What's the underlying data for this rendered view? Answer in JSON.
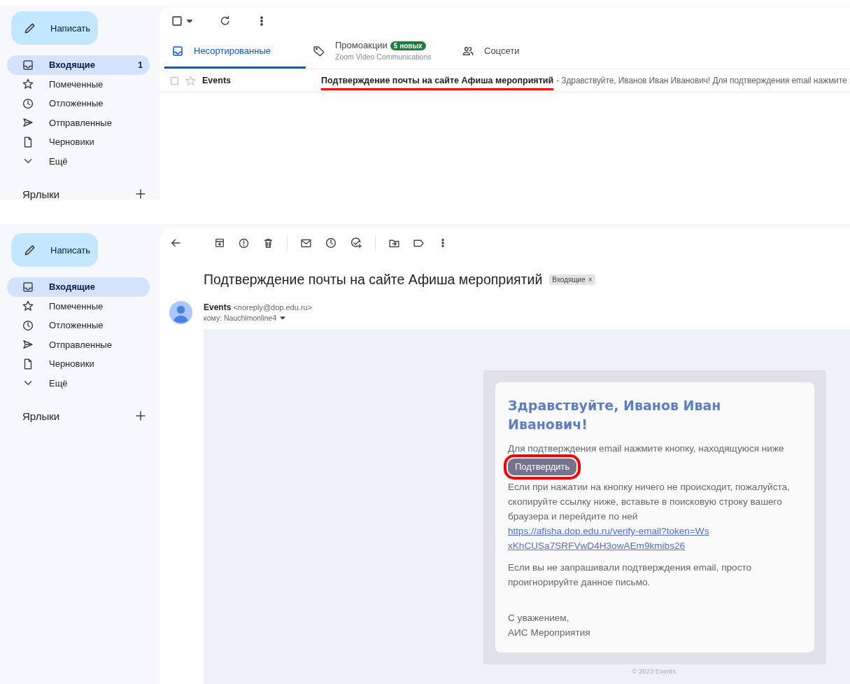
{
  "inbox_view": {
    "sidebar": {
      "compose": "Написать",
      "items": [
        {
          "label": "Входящие",
          "count": "1",
          "selected": true
        },
        {
          "label": "Помеченные",
          "selected": false
        },
        {
          "label": "Отложенные",
          "selected": false
        },
        {
          "label": "Отправленные",
          "selected": false
        },
        {
          "label": "Черновики",
          "selected": false
        },
        {
          "label": "Ещё",
          "selected": false
        }
      ],
      "labels_title": "Ярлыки"
    },
    "tabs": [
      {
        "label": "Несортированные",
        "selected": true
      },
      {
        "label": "Промоакции",
        "badge": "5 новых",
        "subtitle": "Zoom Video Communications",
        "selected": false
      },
      {
        "label": "Соцсети",
        "selected": false
      }
    ],
    "rows": [
      {
        "sender": "Events",
        "subject": "Подтверждение почты на сайте Афиша мероприятий",
        "snippet": "- Здравствуйте, Иванов Иван Иванович! Для подтверждения email нажмите",
        "unread": true,
        "starred": false,
        "annotated": true
      }
    ]
  },
  "message_view": {
    "sidebar": {
      "compose": "Написать",
      "items": [
        {
          "label": "Входящие",
          "selected": true
        },
        {
          "label": "Помеченные",
          "selected": false
        },
        {
          "label": "Отложенные",
          "selected": false
        },
        {
          "label": "Отправленные",
          "selected": false
        },
        {
          "label": "Черновики",
          "selected": false
        },
        {
          "label": "Ещё",
          "selected": false
        }
      ],
      "labels_title": "Ярлыки"
    },
    "subject": "Подтверждение почты на сайте Афиша мероприятий",
    "label_chip": "Входящие",
    "label_chip_close": "×",
    "sender_name": "Events",
    "sender_email": "<noreply@dop.edu.ru>",
    "recipient": "кому: Nauchimonline4",
    "email": {
      "greeting": "Здравствуйте, Иванов Иван Иванович!",
      "instruction": "Для подтверждения email нажмите кнопку, находящуюся ниже",
      "button": {
        "label": "Подтвердить",
        "annotated": true
      },
      "fallback": "Если при нажатии на кнопку ничего не происходит, пожалуйста, скопируйте ссылку ниже, вставьте в поисковую строку вашего браузера и перейдите по ней",
      "link": "https://afisha.dop.edu.ru/verify-email?token=WsxKhCUSa7SRFVwD4H3owAEm9kmibs26",
      "ignore_note": "Если вы не запрашивали подтверждения email, просто проигнорируйте данное письмо.",
      "closing": "С уважением,",
      "signature": "АИС Мероприятия",
      "footer": "© 2023 Events."
    }
  }
}
